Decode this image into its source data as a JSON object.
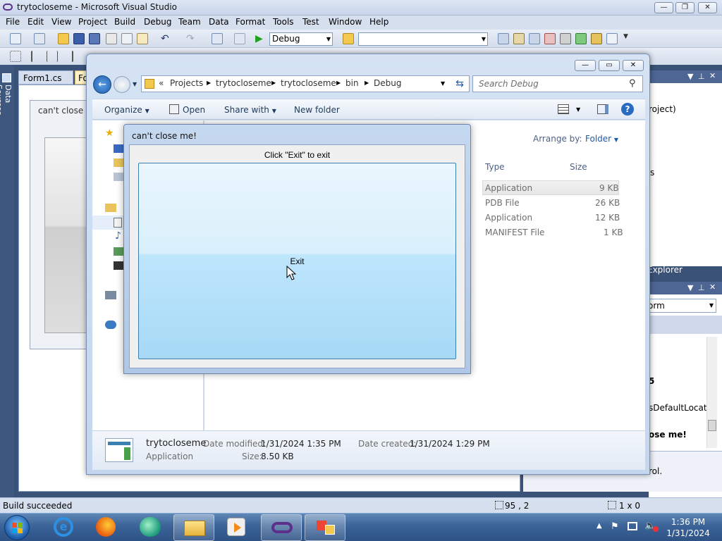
{
  "vs": {
    "title": "trytocloseme - Microsoft Visual Studio",
    "menu": [
      "File",
      "Edit",
      "View",
      "Project",
      "Build",
      "Debug",
      "Team",
      "Data",
      "Format",
      "Tools",
      "Test",
      "Window",
      "Help"
    ],
    "config_combo": "Debug",
    "tab_form1": "Form1.cs",
    "tab_form2": "Form",
    "designer_form_title": "can't close m",
    "side_tab_data_sources": "Data Sources",
    "right_pane1_text1": "roject)",
    "right_pane1_text2": "s",
    "explorer_tab": "Explorer",
    "props_combo": "orm",
    "props_rows": [
      "5",
      "sDefaultLocati",
      "ose me!"
    ],
    "desc_text": "rol."
  },
  "explorer": {
    "breadcrumb": [
      "«",
      "Projects",
      "trytocloseme",
      "trytocloseme",
      "bin",
      "Debug"
    ],
    "search_placeholder": "Search Debug",
    "commands": {
      "organize": "Organize",
      "open": "Open",
      "share": "Share with",
      "new_folder": "New folder"
    },
    "arrange_by_label": "Arrange by:",
    "arrange_by_value": "Folder",
    "columns": {
      "type": "Type",
      "size": "Size"
    },
    "files": [
      {
        "type": "Application",
        "size": "9 KB"
      },
      {
        "type": "PDB File",
        "size": "26 KB"
      },
      {
        "type": "Application",
        "size": "12 KB"
      },
      {
        "type": "MANIFEST File",
        "size": "1 KB"
      }
    ],
    "details": {
      "name": "trytocloseme",
      "kind": "Application",
      "modified_label": "Date modified:",
      "modified_value": "1/31/2024 1:35 PM",
      "created_label": "Date created:",
      "created_value": "1/31/2024 1:29 PM",
      "size_label": "Size:",
      "size_value": "8.50 KB"
    }
  },
  "dialog": {
    "title": "can't close me!",
    "instruction": "Click \"Exit\" to exit",
    "exit_label": "Exit"
  },
  "status": {
    "message": "Build succeeded",
    "position": "95 , 2",
    "size": "1 x 0"
  },
  "taskbar": {
    "time": "1:36 PM",
    "date": "1/31/2024"
  },
  "colors": {
    "accent": "#3c7fb1",
    "taskbar": "#3b6397",
    "vs_blue": "#293955"
  }
}
